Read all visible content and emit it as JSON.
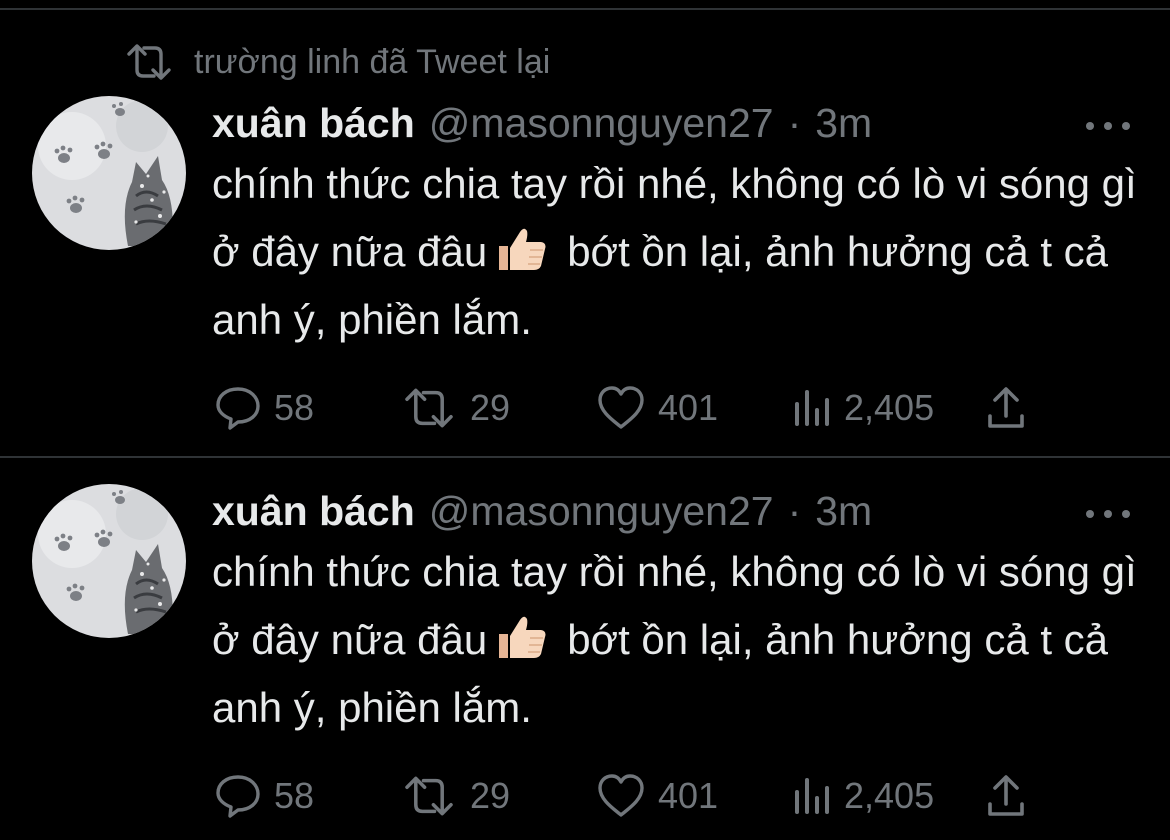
{
  "retweet_banner": {
    "text": "trường linh đã Tweet lại"
  },
  "tweets": [
    {
      "author": {
        "name": "xuân bách",
        "handle": "@masonnguyen27",
        "separator": "·",
        "time": "3m"
      },
      "text_parts": [
        "chính thức chia tay rồi nhé, không có lò vi sóng gì ở đây nữa đâu",
        "bớt ồn lại, ảnh hưởng cả t cả anh ý, phiền lắm."
      ],
      "emoji": "thumbs-up-icon",
      "metrics": {
        "replies": "58",
        "retweets": "29",
        "likes": "401",
        "views": "2,405"
      }
    },
    {
      "author": {
        "name": "xuân bách",
        "handle": "@masonnguyen27",
        "separator": "·",
        "time": "3m"
      },
      "text_parts": [
        "chính thức chia tay rồi nhé, không có lò vi sóng gì ở đây nữa đâu",
        "bớt ồn lại, ảnh hưởng cả t cả anh ý, phiền lắm."
      ],
      "emoji": "thumbs-up-icon",
      "metrics": {
        "replies": "58",
        "retweets": "29",
        "likes": "401",
        "views": "2,405"
      }
    }
  ],
  "colors": {
    "background": "#000000",
    "text": "#e7e9ea",
    "secondary": "#71767b",
    "divider": "#2f3336"
  }
}
